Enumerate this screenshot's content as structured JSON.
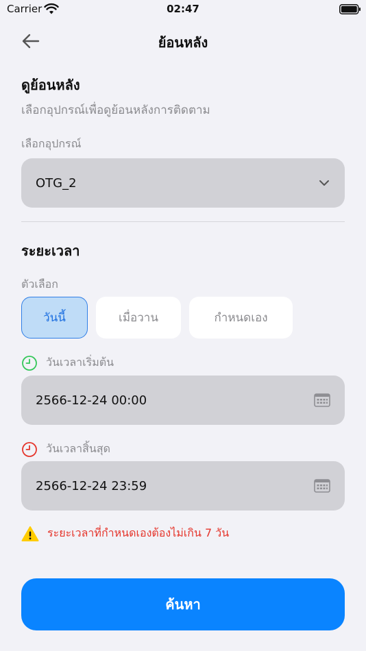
{
  "status_bar": {
    "carrier": "Carrier",
    "time": "02:47"
  },
  "nav": {
    "title": "ย้อนหลัง"
  },
  "history": {
    "title": "ดูย้อนหลัง",
    "subtitle": "เลือกอุปกรณ์เพื่อดูย้อนหลังการติดตาม",
    "device_label": "เลือกอุปกรณ์",
    "device_value": "OTG_2"
  },
  "period": {
    "title": "ระยะเวลา",
    "options_label": "ตัวเลือก",
    "options": [
      "วันนี้",
      "เมื่อวาน",
      "กำหนดเอง"
    ],
    "selected": "วันนี้",
    "start_label": "วันเวลาเริ่มต้น",
    "start_value": "2566-12-24 00:00",
    "end_label": "วันเวลาสิ้นสุด",
    "end_value": "2566-12-24 23:59",
    "warning": "ระยะเวลาที่กำหนดเองต้องไม่เกิน 7 วัน"
  },
  "search_button": "ค้นหา",
  "colors": {
    "accent": "#0a84ff",
    "start_icon": "#34c759",
    "end_icon": "#e5352b",
    "warning_icon": "#ffcc00"
  }
}
